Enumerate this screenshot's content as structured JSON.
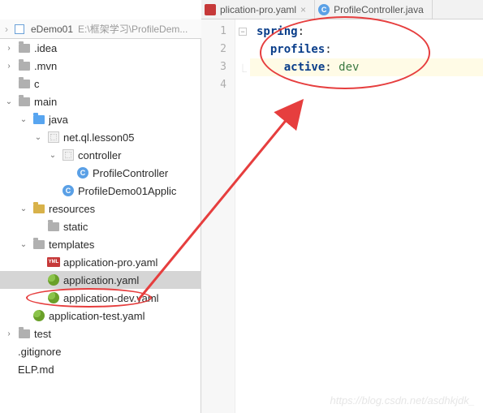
{
  "tabs": [
    {
      "label": "plication-pro.yaml",
      "icon": "yaml"
    },
    {
      "label": "ProfileController.java",
      "icon": "class"
    }
  ],
  "breadcrumb": {
    "root": "eDemo01",
    "path": "E:\\框架学习\\ProfileDem..."
  },
  "tree": {
    "n0": ".idea",
    "n1": ".mvn",
    "n2": "c",
    "n3": "main",
    "n4": "java",
    "n5": "net.ql.lesson05",
    "n6": "controller",
    "n7": "ProfileController",
    "n8": "ProfileDemo01Applic",
    "n9": "resources",
    "n10": "static",
    "n11": "templates",
    "n12": "application-pro.yaml",
    "n13": "application.yaml",
    "n14": "application-dev.yaml",
    "n15": "application-test.yaml",
    "n16": "test",
    "n17": ".gitignore",
    "n18": "ELP.md"
  },
  "editor": {
    "gutter": [
      "1",
      "2",
      "3",
      "4"
    ],
    "line1_key": "spring",
    "line2_key": "profiles",
    "line3_key": "active",
    "line3_val": "dev",
    "colon": ":"
  },
  "watermark": "https://blog.csdn.net/asdhkjdk_"
}
